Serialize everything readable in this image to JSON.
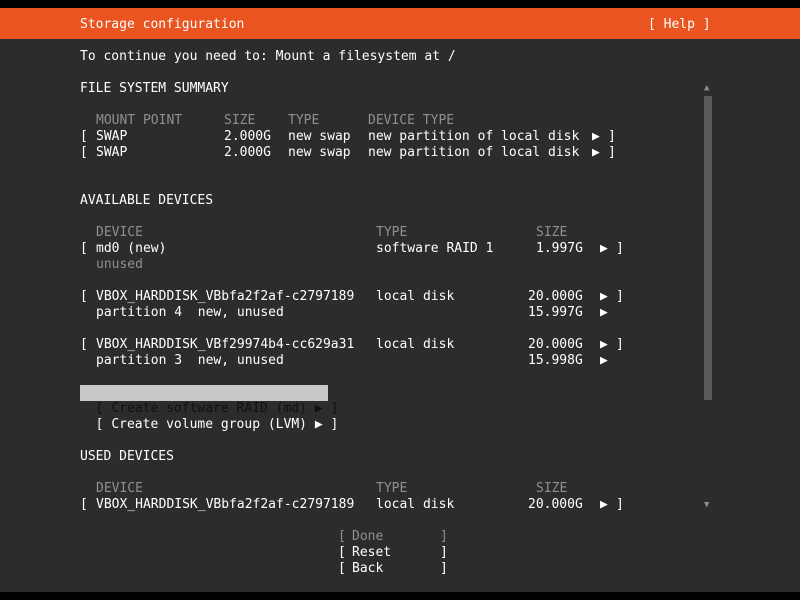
{
  "header": {
    "title": "Storage configuration",
    "help": "[ Help ]"
  },
  "instruction": "To continue you need to: Mount a filesystem at /",
  "fs_summary": {
    "heading": "FILE SYSTEM SUMMARY",
    "columns": {
      "mount_point": "MOUNT POINT",
      "size": "SIZE",
      "type": "TYPE",
      "device_type": "DEVICE TYPE"
    },
    "rows": [
      {
        "mount": "SWAP",
        "size": "2.000G",
        "type": "new swap",
        "device_type": "new partition of local disk"
      },
      {
        "mount": "SWAP",
        "size": "2.000G",
        "type": "new swap",
        "device_type": "new partition of local disk"
      }
    ]
  },
  "available": {
    "heading": "AVAILABLE DEVICES",
    "columns": {
      "device": "DEVICE",
      "type": "TYPE",
      "size": "SIZE"
    },
    "devices": [
      {
        "name": "md0 (new)",
        "type": "software RAID 1",
        "size": "1.997G",
        "sub": "unused"
      },
      {
        "name": "VBOX_HARDDISK_VBbfa2f2af-c2797189",
        "type": "local disk",
        "size": "20.000G",
        "sub": "partition 4  new, unused",
        "sub_size": "15.997G"
      },
      {
        "name": "VBOX_HARDDISK_VBf29974b4-cc629a31",
        "type": "local disk",
        "size": "20.000G",
        "sub": "partition 3  new, unused",
        "sub_size": "15.998G"
      }
    ],
    "create_raid": "Create software RAID (md)",
    "create_lvm": "Create volume group (LVM)"
  },
  "used": {
    "heading": "USED DEVICES",
    "columns": {
      "device": "DEVICE",
      "type": "TYPE",
      "size": "SIZE"
    },
    "devices": [
      {
        "name": "VBOX_HARDDISK_VBbfa2f2af-c2797189",
        "type": "local disk",
        "size": "20.000G"
      }
    ]
  },
  "buttons": {
    "done": "Done",
    "reset": "Reset",
    "back": "Back"
  },
  "glyphs": {
    "arrow": "▶",
    "open": "[",
    "close": "]",
    "scroll_up": "▲",
    "scroll_down": "▼"
  },
  "colors": {
    "accent": "#e95420",
    "background": "#2c2c2c",
    "text": "#ffffff",
    "dim": "#8f8f8f",
    "selected": "#c8c8c8"
  }
}
